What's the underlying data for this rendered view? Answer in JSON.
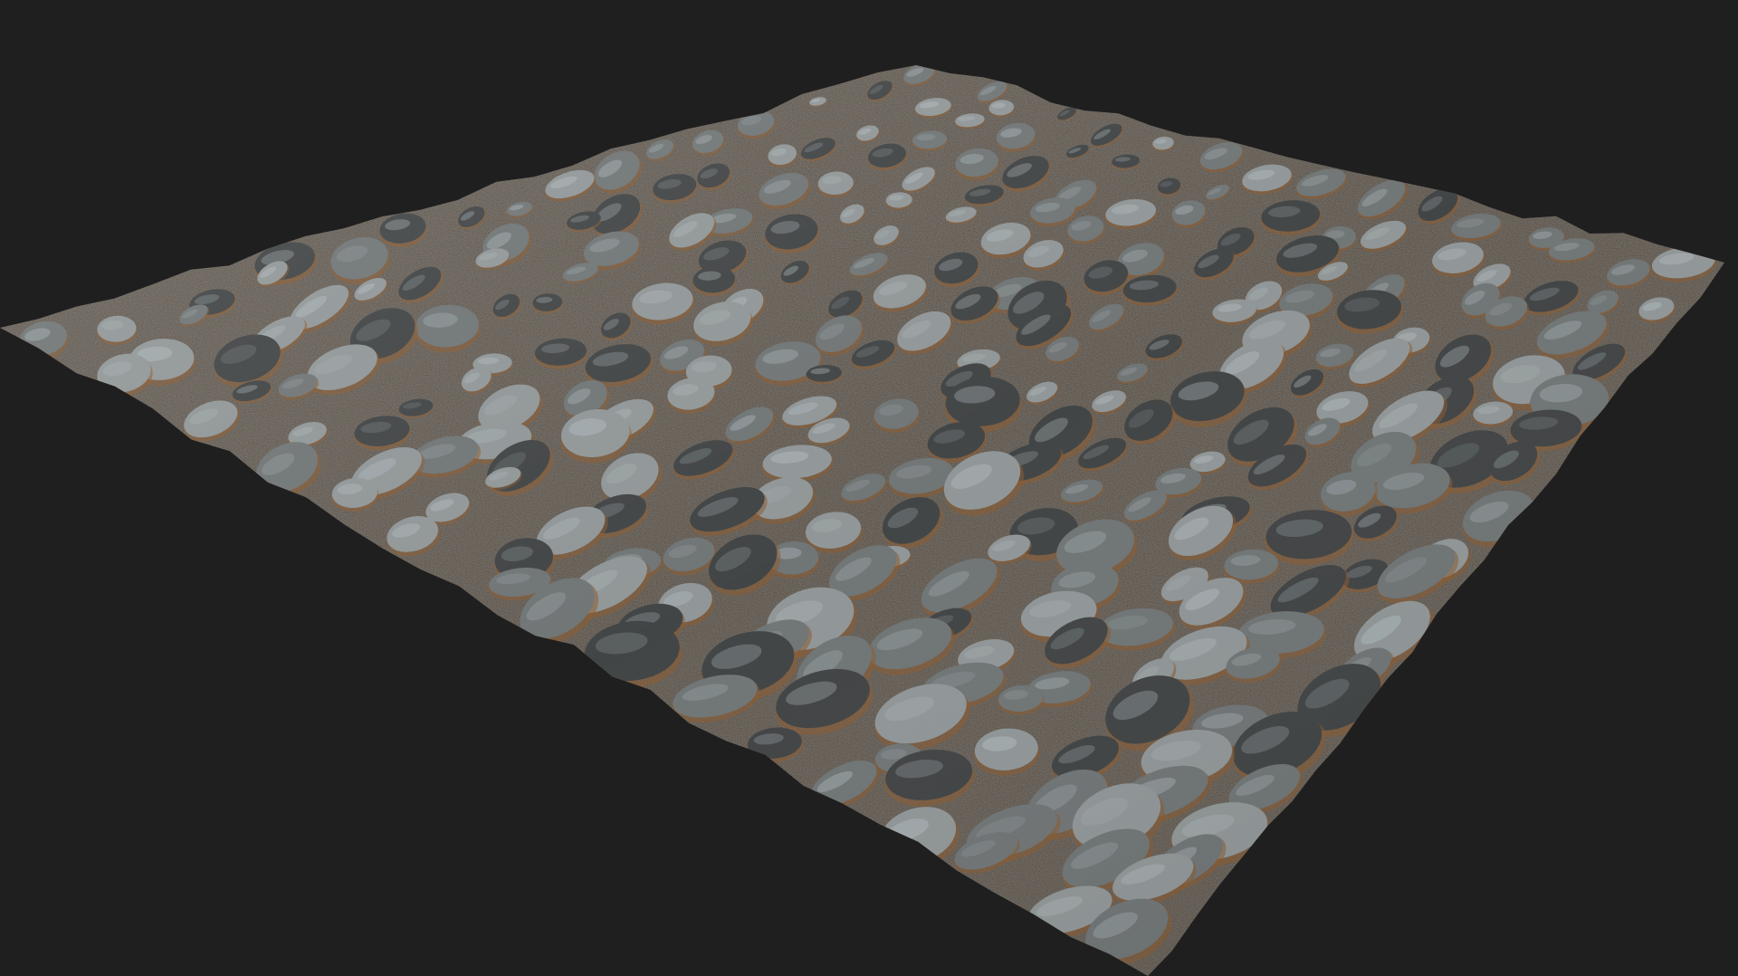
{
  "scene": {
    "subject": "cobblestone-material-plane",
    "colors": {
      "background": "#1f1f1f",
      "ground": "#4a443c",
      "gravel": "#6b6155",
      "stone_light": "#8f9596",
      "stone_mid": "#6e7374",
      "stone_dark": "#3f4243",
      "wet_highlight": "#c7d3d8",
      "rust_edge": "#8a5a2e"
    }
  }
}
